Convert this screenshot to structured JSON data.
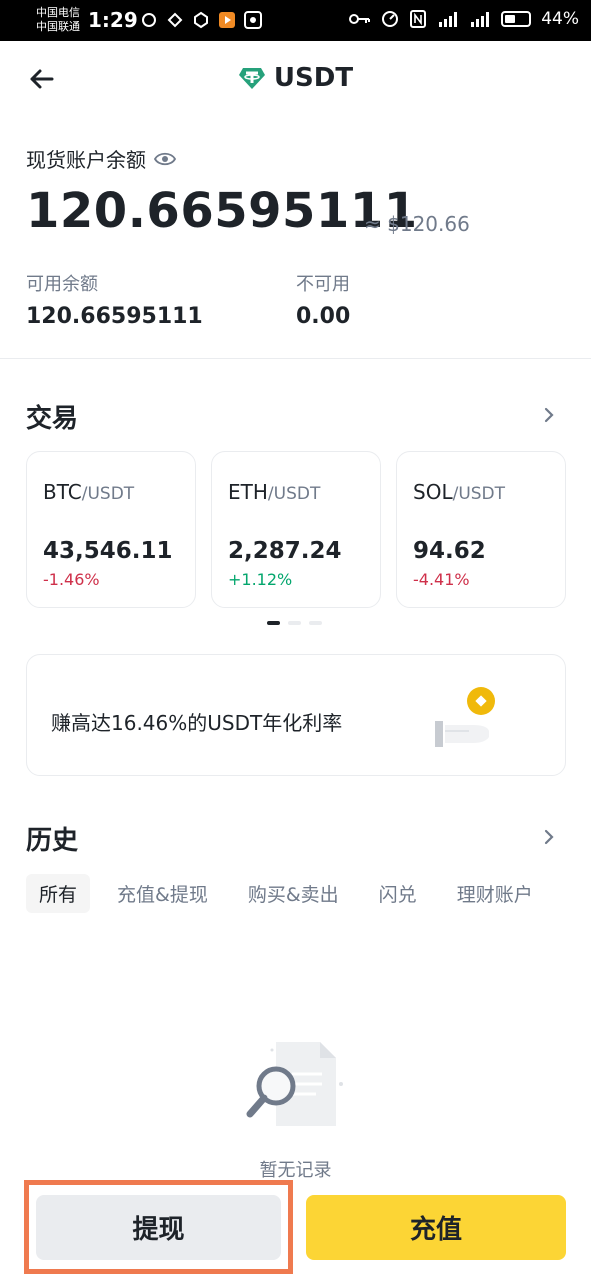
{
  "status_bar": {
    "carrier_1": "中国电信",
    "carrier_2": "中国联通",
    "time": "1:29",
    "battery": "44%"
  },
  "header": {
    "title": "USDT",
    "coin_icon": "tether-icon",
    "brand_color": "#26a17b"
  },
  "balance": {
    "label": "现货账户余额",
    "amount": "120.66595111",
    "approx": "≈ $120.66",
    "available_label": "可用余额",
    "available_value": "120.66595111",
    "unavailable_label": "不可用",
    "unavailable_value": "0.00"
  },
  "trade": {
    "title": "交易",
    "markets": [
      {
        "base": "BTC",
        "quote": "/USDT",
        "price": "43,546.11",
        "change": "-1.46%",
        "direction": "down"
      },
      {
        "base": "ETH",
        "quote": "/USDT",
        "price": "2,287.24",
        "change": "+1.12%",
        "direction": "up"
      },
      {
        "base": "SOL",
        "quote": "/USDT",
        "price": "94.62",
        "change": "-4.41%",
        "direction": "down"
      }
    ]
  },
  "promo": {
    "text": "赚高达16.46%的USDT年化利率"
  },
  "history": {
    "title": "历史",
    "tabs": [
      "所有",
      "充值&提现",
      "购买&卖出",
      "闪兑",
      "理财账户"
    ],
    "active_tab": "所有",
    "empty_text": "暂无记录"
  },
  "actions": {
    "withdraw_label": "提现",
    "deposit_label": "充值"
  },
  "colors": {
    "accent": "#fcd535",
    "down": "#cf304a",
    "up": "#03a66d",
    "highlight": "#ef7a4f"
  }
}
